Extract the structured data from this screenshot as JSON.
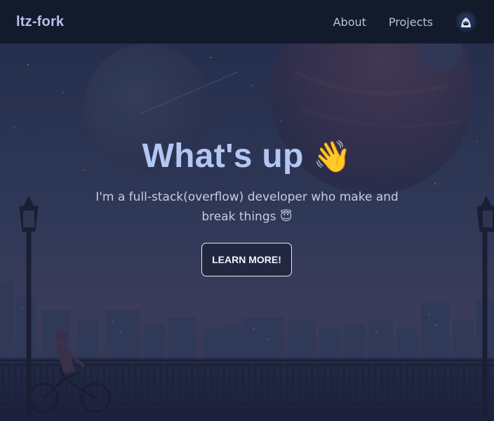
{
  "nav": {
    "brand": "ltz-fork",
    "links": [
      {
        "label": "About"
      },
      {
        "label": "Projects"
      }
    ],
    "avatar_icon": "hooded-figure-avatar"
  },
  "hero": {
    "headline": "What's up",
    "headline_emoji": "👋",
    "subtitle_line1": "I'm a full-stack(overflow) developer who make and",
    "subtitle_line2": "break things",
    "subtitle_emoji": "😇",
    "cta_label": "LEARN MORE!"
  },
  "colors": {
    "nav_bg": "#121a2c",
    "headline": "#b2c7f2",
    "text": "#c3cde3",
    "button_border": "#e6ebf5"
  }
}
